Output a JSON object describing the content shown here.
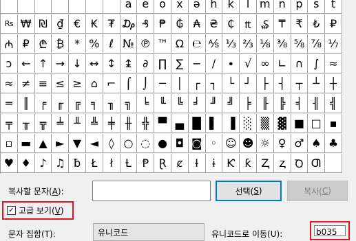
{
  "grid": {
    "rows": [
      [
        "",
        "",
        "",
        "",
        "",
        "",
        "",
        "a",
        "e",
        "o",
        "x",
        "ə",
        "h",
        "k",
        "l",
        "m",
        "n",
        "p",
        "s",
        "t"
      ],
      [
        "Rs",
        "₩",
        "₪",
        "₫",
        "€",
        "₭",
        "₮",
        "₯",
        "₰",
        "₱",
        "₲",
        "₳",
        "₴",
        "₵",
        "₶",
        "₷",
        "₸",
        "₹",
        "₺",
        "₽"
      ],
      [
        "₼",
        "₽",
        "₾",
        "₿",
        "*",
        "%",
        "ℓ",
        "№",
        "℗",
        "™",
        "Ω",
        "℮",
        "⅍",
        "⅓",
        "⅔",
        "⅛",
        "⅜",
        "⅝",
        "⅞",
        "⅐"
      ],
      [
        "ↄ",
        "←",
        "↑",
        "→",
        "↓",
        "↔",
        "↕",
        "↨",
        "∂",
        "∏",
        "∑",
        "−",
        "∕",
        "∙",
        "√",
        "∞",
        "∟",
        "∩",
        "∫",
        "≈"
      ],
      [
        "≈",
        "≠",
        "≡",
        "≤",
        "≥",
        "⌂",
        "⌐",
        "⌠",
        "⌡",
        "─",
        "│",
        "┌",
        "┐",
        "└",
        "┘",
        "├",
        "┤",
        "┬",
        "┴",
        "┼"
      ],
      [
        "═",
        "║",
        "╒",
        "╓",
        "╔",
        "╕",
        "╖",
        "╗",
        "╘",
        "╙",
        "╚",
        "╛",
        "╜",
        "╝",
        "╞",
        "╟",
        "╠",
        "╡",
        "╢",
        "╣"
      ],
      [
        "╤",
        "╥",
        "╦",
        "╧",
        "╨",
        "╩",
        "╪",
        "╫",
        "╬",
        "▀",
        "▄",
        "█",
        "▌",
        "▐",
        "░",
        "▒",
        "▓",
        "■",
        "□",
        "▪"
      ],
      [
        "▫",
        "▬",
        "▲",
        "►",
        "▼",
        "◄",
        "◊",
        "○",
        "◌",
        "●",
        "◘",
        "◙",
        "◦",
        "☺",
        "☻",
        "☼",
        "♀",
        "♂",
        "♠",
        "♣"
      ],
      [
        "♥",
        "♦",
        "♪",
        "♫",
        "ƀ",
        "Ł",
        "ł",
        "Ƚ",
        "Ᵽ",
        "Ɽ",
        "ȼ",
        "Ɨ",
        "ɨ",
        "Ƙ",
        "ƙ",
        "Ⱬ",
        "ⱬ",
        "Ꝺ",
        "Ƣ",
        ""
      ]
    ]
  },
  "copy": {
    "label": "복사할 문자(",
    "label_key": "A",
    "label_end": "):",
    "value": ""
  },
  "buttons": {
    "select": "선택(",
    "select_key": "S",
    "select_end": ")",
    "copy": "복사(",
    "copy_key": "C",
    "copy_end": ")"
  },
  "advanced": {
    "label": "고급 보기(",
    "key": "V",
    "end": ")",
    "checked": true
  },
  "charset": {
    "label": "문자 집합(T):",
    "value": "유니코드"
  },
  "goto": {
    "label": "유니코드로 이동(U):",
    "value": "b035"
  }
}
